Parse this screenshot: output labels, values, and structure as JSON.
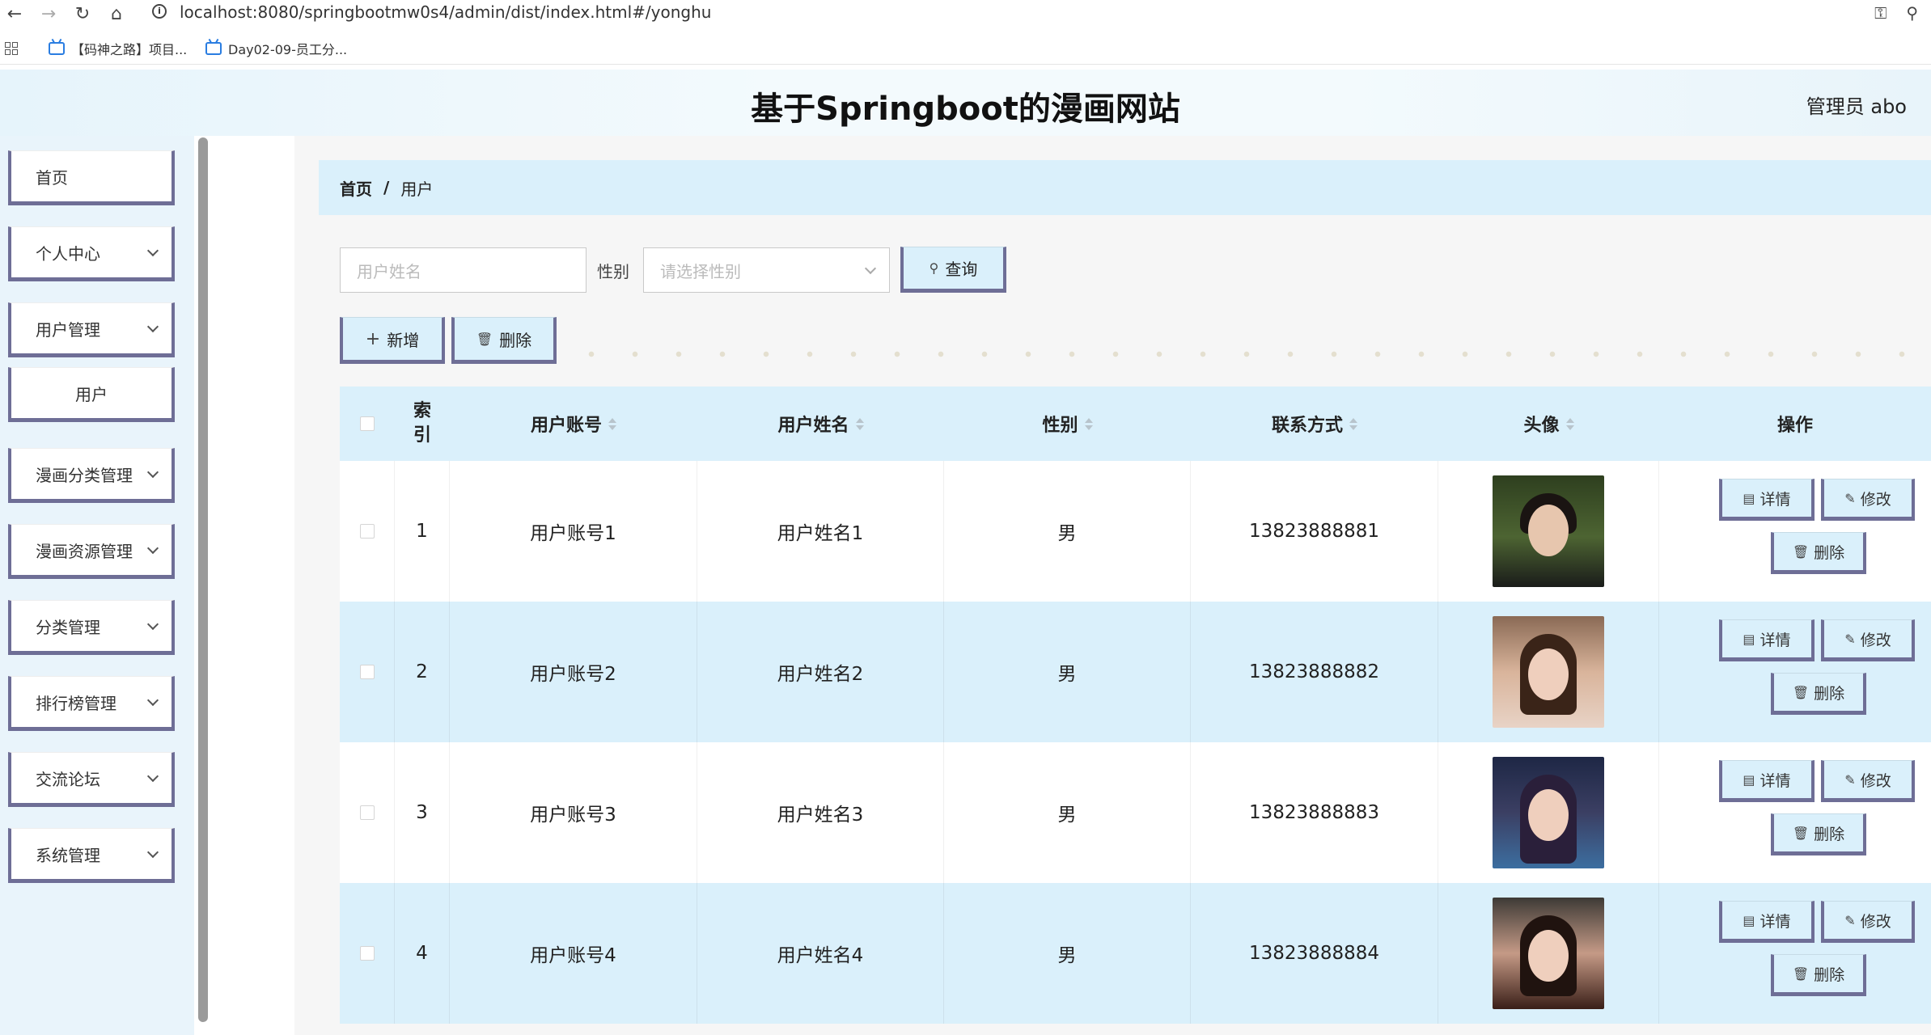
{
  "browser": {
    "url": "localhost:8080/springbootmw0s4/admin/dist/index.html#/yonghu",
    "bookmarks": [
      "【码神之路】项目...",
      "Day02-09-员工分..."
    ]
  },
  "header": {
    "title": "基于Springboot的漫画网站",
    "admin": "管理员 abo"
  },
  "sidebar": {
    "items": [
      {
        "label": "首页"
      },
      {
        "label": "个人中心"
      },
      {
        "label": "用户管理"
      },
      {
        "label": "用户"
      },
      {
        "label": "漫画分类管理"
      },
      {
        "label": "漫画资源管理"
      },
      {
        "label": "分类管理"
      },
      {
        "label": "排行榜管理"
      },
      {
        "label": "交流论坛"
      },
      {
        "label": "系统管理"
      }
    ]
  },
  "breadcrumb": {
    "home": "首页",
    "separator": "/",
    "current": "用户"
  },
  "search": {
    "name_placeholder": "用户姓名",
    "gender_label": "性别",
    "gender_placeholder": "请选择性别",
    "query_label": "查询"
  },
  "toolbar": {
    "add_label": "新增",
    "delete_label": "删除"
  },
  "table": {
    "headers": {
      "index": "索引",
      "account": "用户账号",
      "name": "用户姓名",
      "gender": "性别",
      "phone": "联系方式",
      "avatar": "头像",
      "ops": "操作"
    },
    "rows": [
      {
        "index": "1",
        "account": "用户账号1",
        "name": "用户姓名1",
        "gender": "男",
        "phone": "13823888881"
      },
      {
        "index": "2",
        "account": "用户账号2",
        "name": "用户姓名2",
        "gender": "男",
        "phone": "13823888882"
      },
      {
        "index": "3",
        "account": "用户账号3",
        "name": "用户姓名3",
        "gender": "男",
        "phone": "13823888883"
      },
      {
        "index": "4",
        "account": "用户账号4",
        "name": "用户姓名4",
        "gender": "男",
        "phone": "13823888884"
      }
    ],
    "actions": {
      "detail": "详情",
      "edit": "修改",
      "delete": "删除"
    }
  },
  "colors": {
    "accent": "#daf0fb",
    "button_border": "#6e6e96"
  }
}
